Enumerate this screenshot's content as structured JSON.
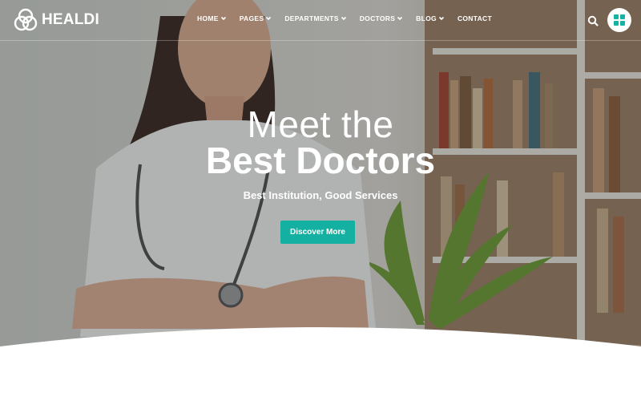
{
  "brand": {
    "name": "HEALDI"
  },
  "nav": {
    "items": [
      {
        "label": "HOME",
        "dropdown": true
      },
      {
        "label": "PAGES",
        "dropdown": true
      },
      {
        "label": "DEPARTMENTS",
        "dropdown": true
      },
      {
        "label": "DOCTORS",
        "dropdown": true
      },
      {
        "label": "BLOG",
        "dropdown": true
      },
      {
        "label": "CONTACT",
        "dropdown": false
      }
    ]
  },
  "header_icons": {
    "search": "search-icon",
    "menu": "grid-menu-icon"
  },
  "hero": {
    "title_line1": "Meet the",
    "title_line2": "Best Doctors",
    "subtitle": "Best Institution, Good Services",
    "cta_label": "Discover More"
  },
  "colors": {
    "accent": "#14b1a2",
    "text_light": "#ffffff"
  }
}
